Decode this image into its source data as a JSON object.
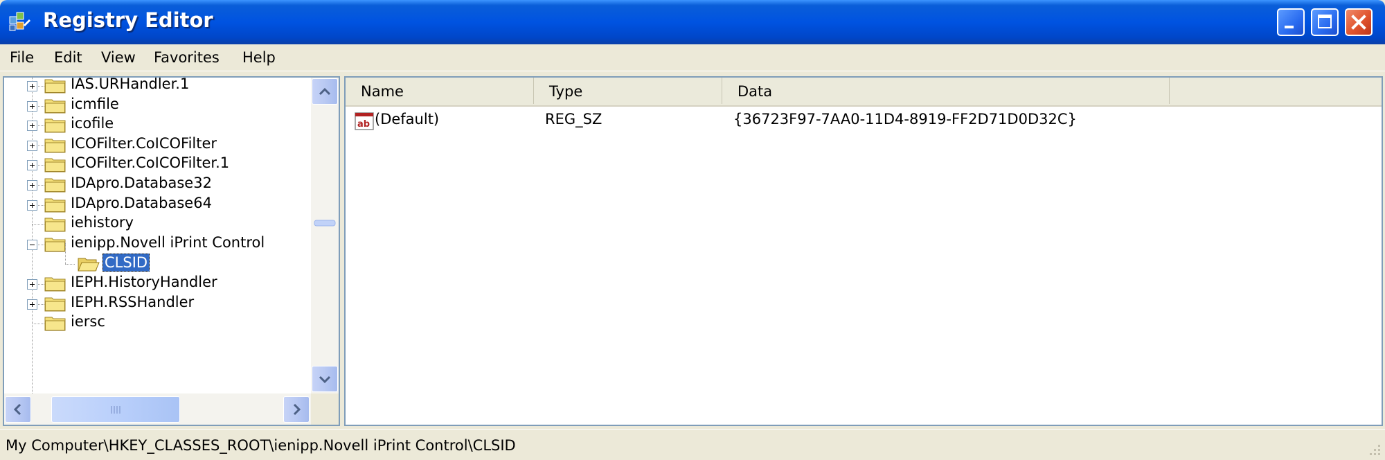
{
  "window": {
    "title": "Registry Editor"
  },
  "menu": [
    "File",
    "Edit",
    "View",
    "Favorites",
    "Help"
  ],
  "tree": {
    "items": [
      {
        "label": "IAS.URHandler.1",
        "expander": "plus",
        "level": 1
      },
      {
        "label": "icmfile",
        "expander": "plus",
        "level": 1
      },
      {
        "label": "icofile",
        "expander": "plus",
        "level": 1
      },
      {
        "label": "ICOFilter.CoICOFilter",
        "expander": "plus",
        "level": 1
      },
      {
        "label": "ICOFilter.CoICOFilter.1",
        "expander": "plus",
        "level": 1
      },
      {
        "label": "IDApro.Database32",
        "expander": "plus",
        "level": 1
      },
      {
        "label": "IDApro.Database64",
        "expander": "plus",
        "level": 1
      },
      {
        "label": "iehistory",
        "expander": "none",
        "level": 1
      },
      {
        "label": "ienipp.Novell iPrint Control",
        "expander": "minus",
        "level": 1
      },
      {
        "label": "CLSID",
        "expander": "none",
        "level": 2,
        "selected": true
      },
      {
        "label": "IEPH.HistoryHandler",
        "expander": "plus",
        "level": 1
      },
      {
        "label": "IEPH.RSSHandler",
        "expander": "plus",
        "level": 1
      },
      {
        "label": "iersc",
        "expander": "none",
        "level": 1
      }
    ]
  },
  "list": {
    "columns": [
      "Name",
      "Type",
      "Data"
    ],
    "rows": [
      {
        "name": "(Default)",
        "type": "REG_SZ",
        "data": "{36723F97-7AA0-11D4-8919-FF2D71D0D32C}"
      }
    ]
  },
  "status": {
    "path": "My Computer\\HKEY_CLASSES_ROOT\\ienipp.Novell iPrint Control\\CLSID"
  },
  "colors": {
    "titlebar": "#0053E1",
    "selection": "#316AC5",
    "close_button": "#E0542E",
    "folder": "#F5E07A"
  }
}
